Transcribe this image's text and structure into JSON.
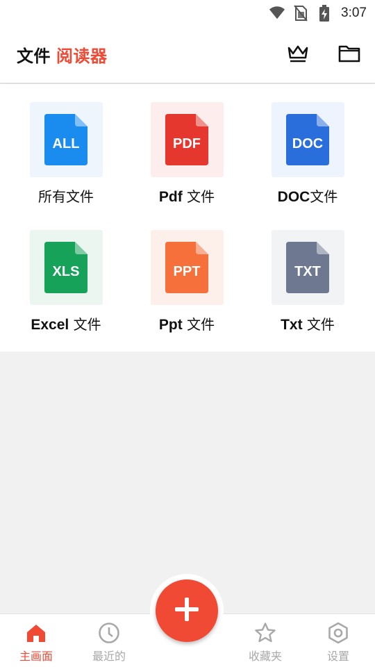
{
  "status_bar": {
    "time": "3:07",
    "icons": [
      "wifi-icon",
      "no-sim-icon",
      "battery-charging-icon"
    ]
  },
  "app_bar": {
    "title_part1": "文件",
    "title_part2": "阅读器",
    "accent_color": "#f04a35",
    "actions": [
      "crown-icon",
      "folder-icon"
    ]
  },
  "categories": [
    {
      "badge": "ALL",
      "label": "所有文件",
      "label_lat": "",
      "label_cjk": "所有文件",
      "color": "#1a8cf0",
      "bg": "#eef5fd"
    },
    {
      "badge": "PDF",
      "label": "Pdf 文件",
      "label_lat": "Pdf",
      "label_cjk": " 文件",
      "color": "#e5372d",
      "bg": "#fdeeed"
    },
    {
      "badge": "DOC",
      "label": "DOC文件",
      "label_lat": "DOC",
      "label_cjk": "文件",
      "color": "#2a6edc",
      "bg": "#eef4fd"
    },
    {
      "badge": "XLS",
      "label": "Excel 文件",
      "label_lat": "Excel",
      "label_cjk": " 文件",
      "color": "#17a25a",
      "bg": "#ebf6f0"
    },
    {
      "badge": "PPT",
      "label": "Ppt 文件",
      "label_lat": "Ppt",
      "label_cjk": " 文件",
      "color": "#f5703a",
      "bg": "#fdf0ea"
    },
    {
      "badge": "TXT",
      "label": "Txt 文件",
      "label_lat": "Txt",
      "label_cjk": " 文件",
      "color": "#6f7891",
      "bg": "#f2f3f5"
    }
  ],
  "bottom_nav": {
    "items": [
      {
        "label": "主画面",
        "icon": "home-icon",
        "active": true
      },
      {
        "label": "最近的",
        "icon": "clock-icon",
        "active": false
      },
      {
        "label": "收藏夹",
        "icon": "star-icon",
        "active": false
      },
      {
        "label": "设置",
        "icon": "settings-icon",
        "active": false
      }
    ],
    "fab_icon": "plus-icon",
    "active_color": "#f04a35",
    "inactive_color": "#a8a8a8"
  }
}
